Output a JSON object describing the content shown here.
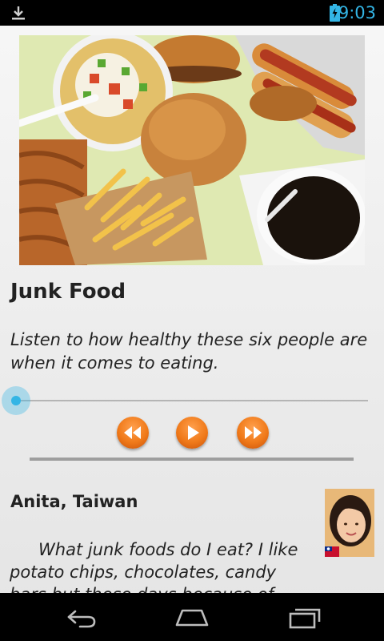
{
  "status_bar": {
    "time": "9:03",
    "icons": [
      "download-icon",
      "battery-charging-icon"
    ],
    "accent_color": "#33b5e5"
  },
  "lesson": {
    "image": "junk-food-photo",
    "title": "Junk Food",
    "description": "Listen to how healthy these six people are when it comes to eating."
  },
  "player": {
    "progress": 0,
    "controls": [
      {
        "name": "rewind",
        "icon": "rewind-icon"
      },
      {
        "name": "play",
        "icon": "play-icon"
      },
      {
        "name": "fast-forward",
        "icon": "fast-forward-icon"
      }
    ],
    "button_color": "#f07a1a"
  },
  "speaker": {
    "name": "Anita, Taiwan",
    "avatar": "speaker-avatar",
    "transcript": "What junk foods do I eat? I like potato chips, chocolates, candy bars but these days because of"
  },
  "nav_bar": {
    "buttons": [
      "back-icon",
      "home-icon",
      "recent-apps-icon"
    ]
  }
}
